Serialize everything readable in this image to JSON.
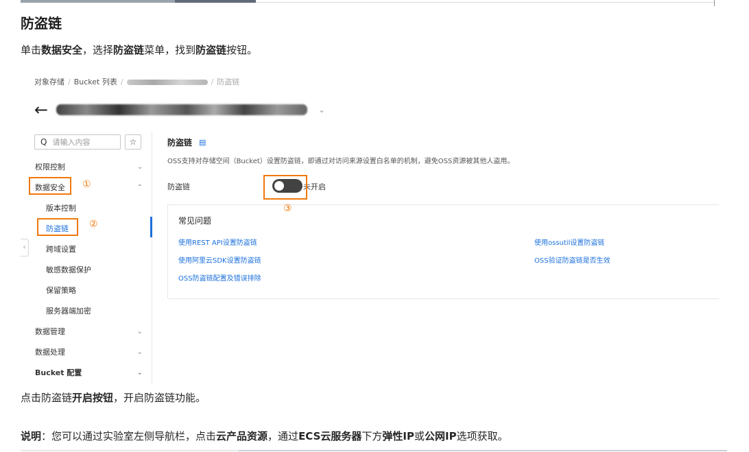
{
  "doc": {
    "heading": "防盗链",
    "step1": {
      "t1": "单击",
      "b1": "数据安全",
      "t2": "，选择",
      "b2": "防盗链",
      "t3": "菜单，找到",
      "b3": "防盗链",
      "t4": "按钮。"
    },
    "step2": {
      "t1": "点击防盗链",
      "b1": "开启按钮",
      "t2": "，开启防盗链功能。"
    },
    "note": {
      "b1": "说明",
      "t1": "：您可以通过实验室左侧导航栏，点击",
      "b2": "云产品资源",
      "t2": "，通过",
      "b3": "ECS云服务器",
      "t3": "下方",
      "b4": "弹性IP",
      "t4": "或",
      "b5": "公网IP",
      "t5": "选项获取。"
    }
  },
  "screenshot": {
    "breadcrumb": [
      "对象存储",
      "Bucket 列表",
      "防盗链"
    ],
    "back_icon": "←",
    "title_chevron": "⌄",
    "search": {
      "placeholder": "请输入内容",
      "icon": "search-icon",
      "glyph": "Q"
    },
    "star_glyph": "☆",
    "nav": {
      "auth": "权限控制",
      "security": "数据安全",
      "version": "版本控制",
      "hotlink": "防盗链",
      "cors": "跨域设置",
      "sensitive": "敏感数据保护",
      "retention": "保留策略",
      "encryption": "服务器端加密",
      "manage": "数据管理",
      "process": "数据处理",
      "bucket_config": "Bucket 配置"
    },
    "chevrons": {
      "down": "⌄",
      "up": "⌃"
    },
    "collapse_glyph": "‹",
    "markers": {
      "one": "①",
      "two": "②",
      "three": "③"
    },
    "main": {
      "title": "防盗链",
      "doc_icon_glyph": "▤",
      "description": "OSS支持对存储空间（Bucket）设置防盗链，即通过对访问来源设置白名单的机制，避免OSS资源被其他人盗用。",
      "toggle_label": "防盗链",
      "toggle_state": "未开启",
      "toggle_on": false
    },
    "faq": {
      "title": "常见问题",
      "links": [
        "使用REST API设置防盗链",
        "使用ossutil设置防盗链",
        "使用阿里云SDK设置防盗链",
        "OSS验证防盗链是否生效",
        "OSS防盗链配置及错误排除"
      ]
    },
    "colors": {
      "accent": "#1a6fdc",
      "highlight": "#f0780a",
      "switch_off": "#424242"
    }
  }
}
